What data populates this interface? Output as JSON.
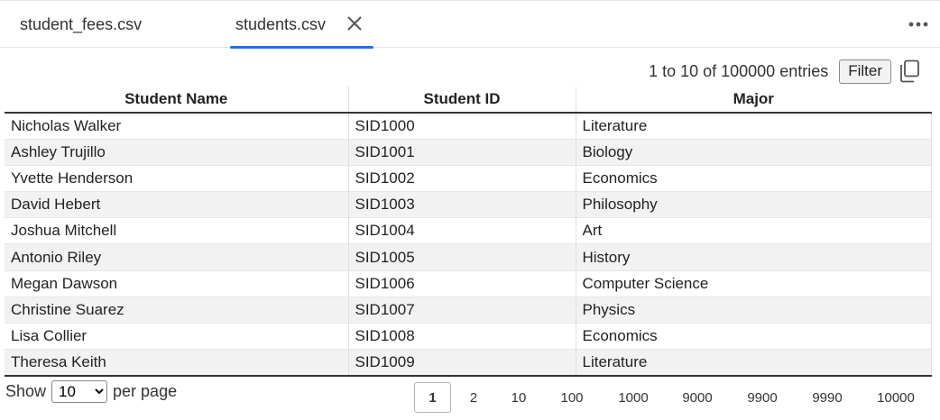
{
  "tabs": [
    {
      "label": "student_fees.csv"
    },
    {
      "label": "students.csv"
    }
  ],
  "toolbar": {
    "entries_text": "1 to 10 of 100000 entries",
    "filter_label": "Filter"
  },
  "table": {
    "columns": [
      "Student Name",
      "Student ID",
      "Major"
    ],
    "rows": [
      [
        "Nicholas Walker",
        "SID1000",
        "Literature"
      ],
      [
        "Ashley Trujillo",
        "SID1001",
        "Biology"
      ],
      [
        "Yvette Henderson",
        "SID1002",
        "Economics"
      ],
      [
        "David Hebert",
        "SID1003",
        "Philosophy"
      ],
      [
        "Joshua Mitchell",
        "SID1004",
        "Art"
      ],
      [
        "Antonio Riley",
        "SID1005",
        "History"
      ],
      [
        "Megan Dawson",
        "SID1006",
        "Computer Science"
      ],
      [
        "Christine Suarez",
        "SID1007",
        "Physics"
      ],
      [
        "Lisa Collier",
        "SID1008",
        "Economics"
      ],
      [
        "Theresa Keith",
        "SID1009",
        "Literature"
      ]
    ]
  },
  "footer": {
    "show_label": "Show",
    "per_page_value": "10",
    "per_page_label": "per page"
  },
  "pagination": {
    "pages": [
      "1",
      "2",
      "10",
      "100",
      "1000",
      "9000",
      "9900",
      "9990",
      "10000"
    ],
    "current": "1"
  },
  "colors": {
    "accent": "#1a73e8",
    "row_alt": "#f2f2f2"
  }
}
